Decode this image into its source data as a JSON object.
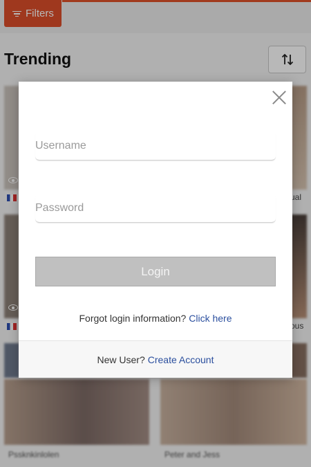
{
  "background": {
    "filters_label": "Filters",
    "section_title": "Trending",
    "sort_icon": "sort-arrows-icon",
    "side_captions": [
      "ual",
      "ous"
    ],
    "bottom_captions": [
      "Pssknkinlolen",
      "Peter and Jess"
    ]
  },
  "login_modal": {
    "username_placeholder": "Username",
    "password_placeholder": "Password",
    "login_label": "Login",
    "forgot_text": "Forgot login information?",
    "forgot_link": "Click here",
    "new_user_text": "New User?",
    "create_account_link": "Create Account",
    "close_icon": "close-icon"
  },
  "colors": {
    "accent": "#dd4e2a",
    "link": "#2b4f9e",
    "login_button_disabled": "#c0c0c0"
  }
}
